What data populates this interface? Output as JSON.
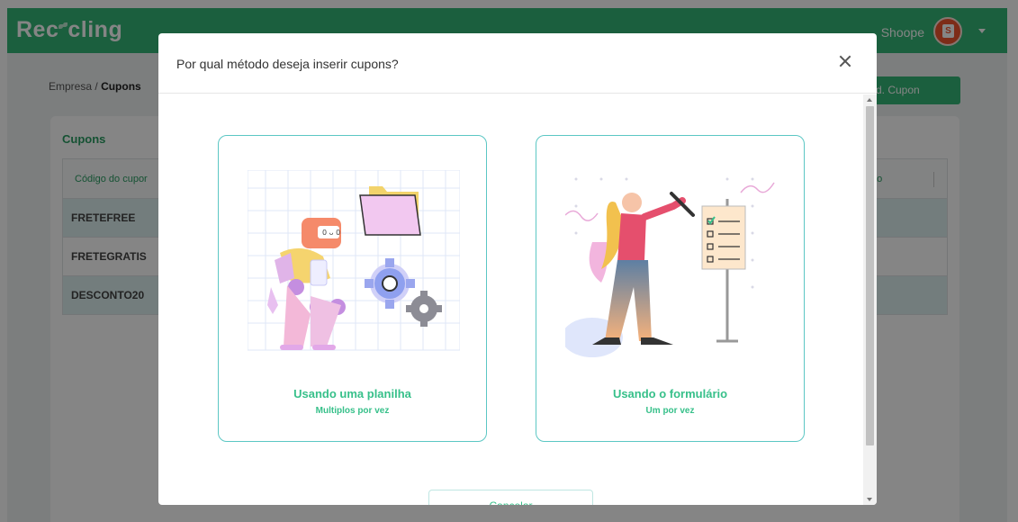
{
  "app": {
    "logo": {
      "pre": "Rec",
      "post": "cling"
    },
    "shop_name": "Shoope",
    "shop_avatar_letter": "S"
  },
  "breadcrumb": {
    "parent": "Empresa",
    "separator": "/",
    "current": "Cupons"
  },
  "add_button_label": "d. Cupon",
  "card": {
    "title": "Cupons",
    "table": {
      "header_first": "Código do cupor",
      "header_last": "ão",
      "rows": [
        "FRETEFREE",
        "FRETEGRATIS",
        "DESCONTO20"
      ]
    }
  },
  "modal": {
    "title": "Por qual método deseja inserir cupons?",
    "options": [
      {
        "title": "Usando uma planilha",
        "subtitle": "Multiplos por vez",
        "icon": "robot-spreadsheet-illustration"
      },
      {
        "title": "Usando o formulário",
        "subtitle": "Um por vez",
        "icon": "person-checklist-illustration"
      }
    ],
    "cancel_label": "Cancelar"
  },
  "colors": {
    "brand": "#35b677",
    "accent": "#37c08a",
    "option_border": "#5cc7c4"
  }
}
